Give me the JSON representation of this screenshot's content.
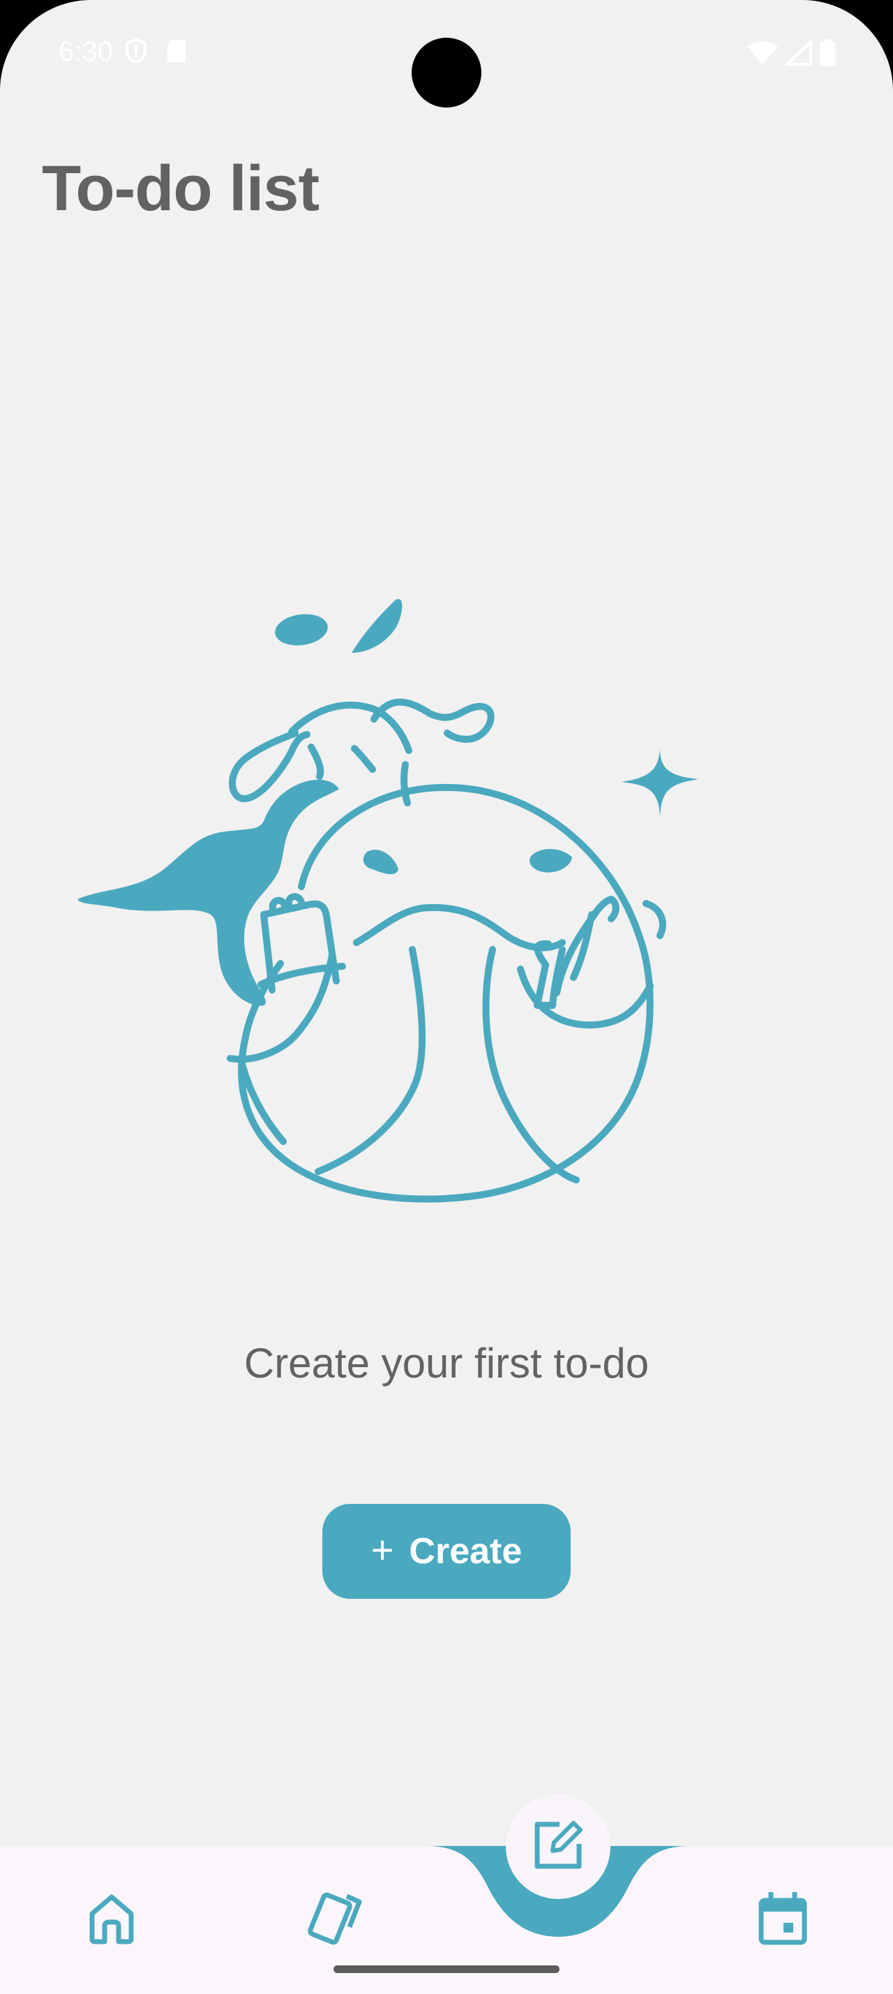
{
  "status_bar": {
    "time": "6:30",
    "icons": [
      "shield-icon",
      "sd-card-icon",
      "wifi-icon",
      "signal-icon",
      "battery-icon"
    ]
  },
  "header": {
    "title": "To-do list"
  },
  "empty_state": {
    "illustration": "whale-writing-notes-illustration",
    "message": "Create your first to-do"
  },
  "create_button": {
    "icon": "plus-icon",
    "label": "Create"
  },
  "bottom_nav": {
    "items": [
      {
        "icon": "home-icon"
      },
      {
        "icon": "cards-icon"
      },
      {
        "icon": "edit-note-icon",
        "active": true
      },
      {
        "icon": "calendar-icon"
      }
    ]
  },
  "colors": {
    "accent": "#4aa9bf",
    "background": "#f1f1f1",
    "title_text": "#626262",
    "nav_background": "#fcf6fc"
  }
}
